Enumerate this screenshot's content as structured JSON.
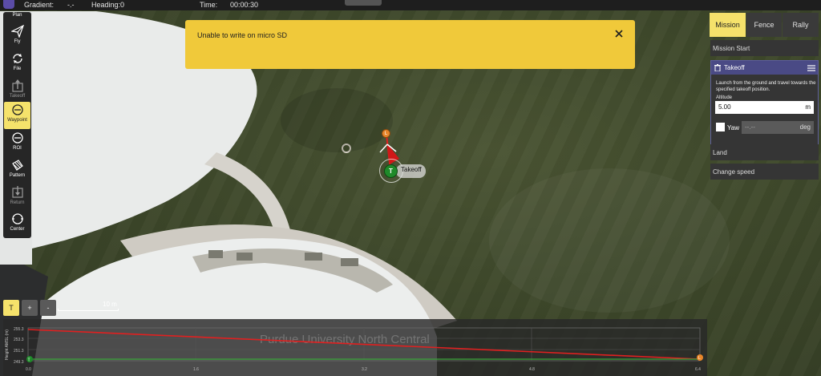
{
  "status_bar": {
    "gradient_label": "Gradient:",
    "gradient_value": "-.-",
    "heading_label": "Heading:",
    "heading_value": "0",
    "time_label": "Time:",
    "time_value": "00:00:30"
  },
  "toolbar": {
    "items": [
      {
        "label": "Plan",
        "icon": "plan-icon"
      },
      {
        "label": "Fly",
        "icon": "paper-plane-icon"
      },
      {
        "label": "File",
        "icon": "sync-icon"
      },
      {
        "label": "Takeoff",
        "icon": "takeoff-icon"
      },
      {
        "label": "Waypoint",
        "icon": "waypoint-icon"
      },
      {
        "label": "ROI",
        "icon": "roi-icon"
      },
      {
        "label": "Pattern",
        "icon": "pattern-icon"
      },
      {
        "label": "Return",
        "icon": "return-icon"
      },
      {
        "label": "Center",
        "icon": "center-icon"
      }
    ],
    "active": "Waypoint"
  },
  "notification": {
    "message": "Unable to write on micro SD",
    "close_icon": "close-icon"
  },
  "map": {
    "takeoff_pin": "T",
    "takeoff_label": "Takeoff",
    "land_pin": "L",
    "watermark": "Purdue University North Central"
  },
  "zoom": {
    "terrain_button": "T",
    "zoom_in": "+",
    "zoom_out": "-",
    "scale_label": "10 m"
  },
  "elevation": {
    "y_axis_label": "Height AMSL (m)",
    "x_ticks": [
      "0.0",
      "1.6",
      "3.2",
      "4.8",
      "6.4"
    ],
    "y_ticks": [
      "255.3",
      "253.3",
      "251.3",
      "249.3"
    ],
    "start_marker": "T",
    "end_marker": "L"
  },
  "right_panel": {
    "tabs": [
      "Mission",
      "Fence",
      "Rally"
    ],
    "active_tab": "Mission",
    "mission_start": "Mission Start",
    "takeoff_card": {
      "title": "Takeoff",
      "description": "Launch from the ground and travel towards the specified takeoff position.",
      "altitude_label": "Altitude",
      "altitude_value": "5.00",
      "altitude_unit": "m",
      "yaw_label": "Yaw",
      "yaw_value": "--.--",
      "yaw_unit": "deg"
    },
    "land": "Land",
    "change_speed": "Change speed"
  },
  "colors": {
    "accent_yellow": "#f5e26b",
    "notification": "#f0c93a",
    "takeoff_green": "#1f8a2a",
    "land_orange": "#e8862a",
    "path_red": "#e02020",
    "card_header": "#4a4a85"
  }
}
